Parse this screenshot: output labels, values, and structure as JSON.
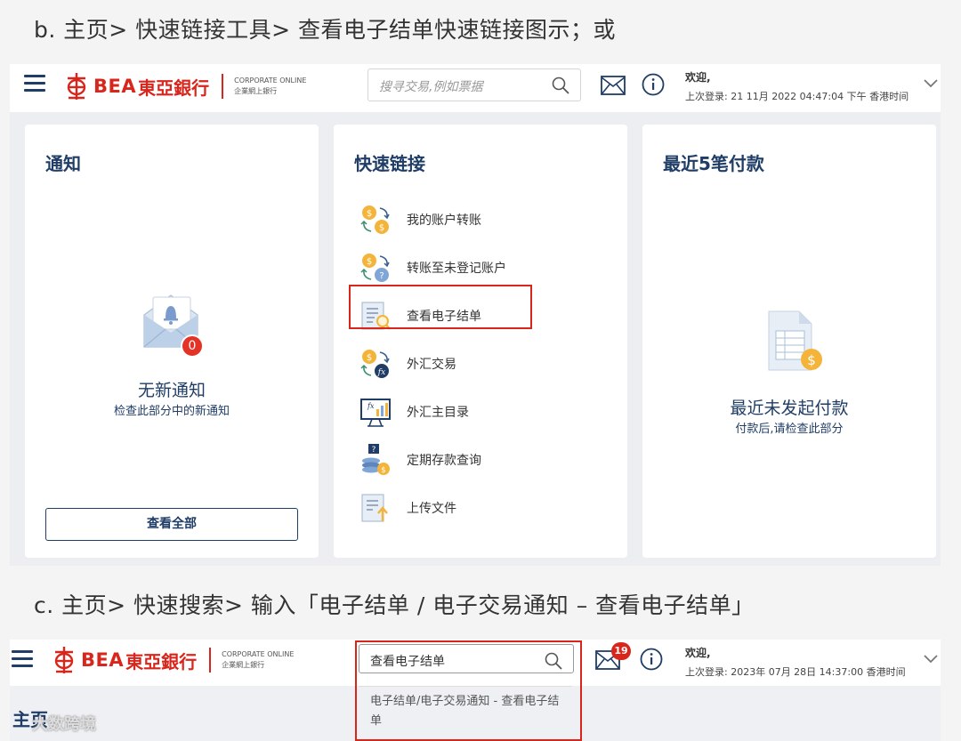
{
  "captions": {
    "b": "b. 主页> 快速链接工具> 查看电子结单快速链接图示；或",
    "c": "c. 主页> 快速搜索> 输入「电子结单 / 电子交易通知 – 查看电子结单」"
  },
  "brand": {
    "logo_text": "BEA",
    "logo_cn": "東亞銀行",
    "corporate_line1": "CORPORATE ONLINE",
    "corporate_line2": "企業網上銀行",
    "accent_color": "#d9261c",
    "navy_color": "#1f3d66"
  },
  "header1": {
    "search_placeholder": "搜寻交易,例如票据",
    "welcome": "欢迎,",
    "last_login": "上次登录: 21 11月 2022 04:47:04 下午 香港时间"
  },
  "header2": {
    "search_value": "查看电子结单",
    "notification_count": "19",
    "welcome": "欢迎,",
    "last_login": "上次登录: 2023年 07月 28日 14:37:00 香港时间",
    "suggestion": "电子结单/电子交易通知 - 查看电子结单"
  },
  "cards": {
    "notice": {
      "title": "通知",
      "count": "0",
      "empty_title": "无新通知",
      "empty_sub": "检查此部分中的新通知",
      "view_all": "查看全部"
    },
    "quicklinks": {
      "title": "快速链接",
      "items": [
        {
          "label": "我的账户转账",
          "icon": "transfer-icon"
        },
        {
          "label": "转账至未登记账户",
          "icon": "transfer-unregistered-icon"
        },
        {
          "label": "查看电子结单",
          "icon": "estatement-icon"
        },
        {
          "label": "外汇交易",
          "icon": "fx-transfer-icon"
        },
        {
          "label": "外汇主目录",
          "icon": "fx-board-icon"
        },
        {
          "label": "定期存款查询",
          "icon": "deposit-icon"
        },
        {
          "label": "上传文件",
          "icon": "upload-icon"
        }
      ]
    },
    "payments": {
      "title": "最近5笔付款",
      "empty_title": "最近未发起付款",
      "empty_sub": "付款后,请检查此部分"
    }
  },
  "page": {
    "title": "主页",
    "watermark": "大数跨境"
  }
}
